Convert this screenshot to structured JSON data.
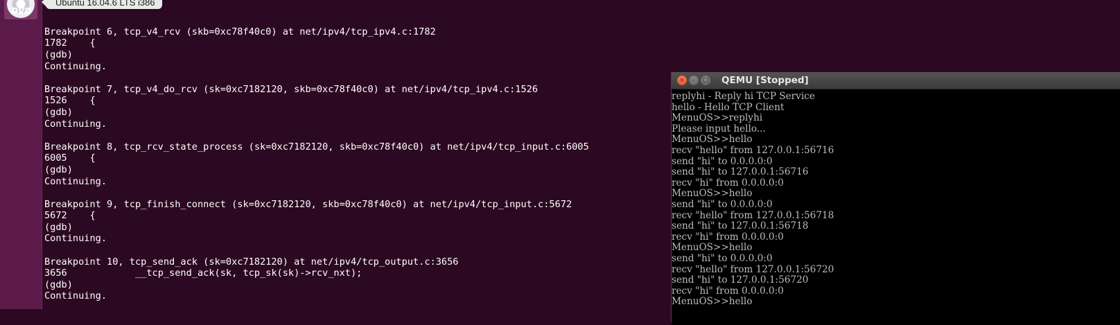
{
  "launcher": {
    "dvd_label": "DVD",
    "tooltip": "Ubuntu 16.04.6 LTS i386"
  },
  "terminal": {
    "lines": [
      "",
      "",
      "",
      "Breakpoint 6, tcp_v4_rcv (skb=0xc78f40c0) at net/ipv4/tcp_ipv4.c:1782",
      "1782\t{",
      "(gdb)",
      "Continuing.",
      "",
      "Breakpoint 7, tcp_v4_do_rcv (sk=0xc7182120, skb=0xc78f40c0) at net/ipv4/tcp_ipv4.c:1526",
      "1526\t{",
      "(gdb)",
      "Continuing.",
      "",
      "Breakpoint 8, tcp_rcv_state_process (sk=0xc7182120, skb=0xc78f40c0) at net/ipv4/tcp_input.c:6005",
      "6005\t{",
      "(gdb)",
      "Continuing.",
      "",
      "Breakpoint 9, tcp_finish_connect (sk=0xc7182120, skb=0xc78f40c0) at net/ipv4/tcp_input.c:5672",
      "5672\t{",
      "(gdb)",
      "Continuing.",
      "",
      "Breakpoint 10, tcp_send_ack (sk=0xc7182120) at net/ipv4/tcp_output.c:3656",
      "3656\t\t__tcp_send_ack(sk, tcp_sk(sk)->rcv_nxt);",
      "(gdb)",
      "Continuing."
    ]
  },
  "qemu": {
    "title": "QEMU [Stopped]",
    "close_glyph": "×",
    "min_glyph": "–",
    "max_glyph": "□",
    "lines": [
      "replyhi - Reply hi TCP Service",
      "hello - Hello TCP Client",
      "MenuOS>>replyhi",
      "Please input hello...",
      "MenuOS>>hello",
      "recv \"hello\" from 127.0.0.1:56716",
      "send \"hi\" to 0.0.0.0:0",
      "send \"hi\" to 127.0.0.1:56716",
      "recv \"hi\" from 0.0.0.0:0",
      "MenuOS>>hello",
      "send \"hi\" to 0.0.0.0:0",
      "recv \"hello\" from 127.0.0.1:56718",
      "send \"hi\" to 127.0.0.1:56718",
      "recv \"hi\" from 0.0.0.0:0",
      "MenuOS>>hello",
      "send \"hi\" to 0.0.0.0:0",
      "recv \"hello\" from 127.0.0.1:56720",
      "send \"hi\" to 127.0.0.1:56720",
      "recv \"hi\" from 0.0.0.0:0",
      "MenuOS>>hello"
    ]
  }
}
